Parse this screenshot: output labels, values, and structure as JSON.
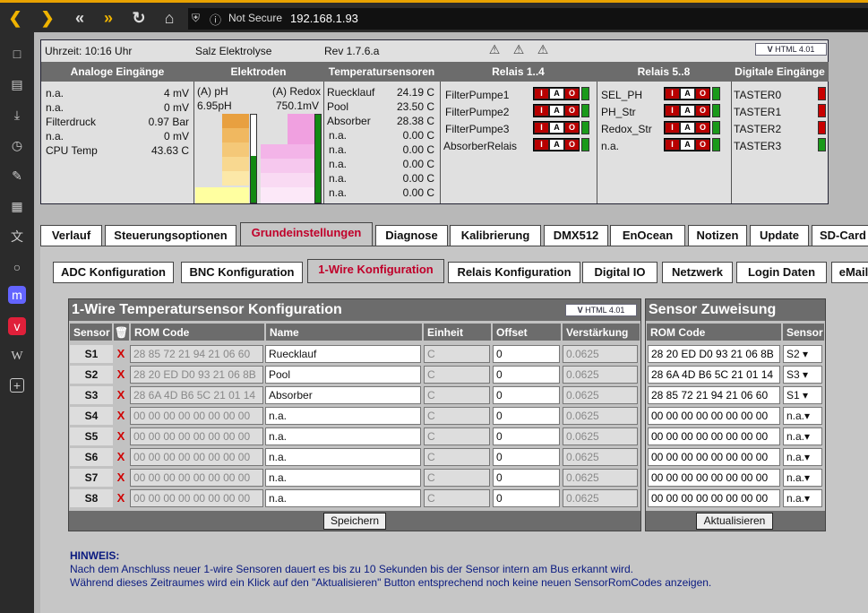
{
  "browser": {
    "not_secure": "Not Secure",
    "url": "192.168.1.93"
  },
  "status": {
    "time": "Uhrzeit: 10:16 Uhr",
    "mode": "Salz Elektrolyse",
    "rev": "Rev 1.7.6.a",
    "validator": "HTML 4.01",
    "headers": [
      "Analoge Eingänge",
      "Elektroden",
      "Temperatursensoren",
      "Relais 1..4",
      "Relais 5..8",
      "Digitale Eingänge"
    ],
    "analog": [
      {
        "label": "n.a.",
        "value": "4 mV"
      },
      {
        "label": "n.a.",
        "value": "0 mV"
      },
      {
        "label": "Filterdruck",
        "value": "0.97 Bar"
      },
      {
        "label": "n.a.",
        "value": "0 mV"
      },
      {
        "label": "CPU Temp",
        "value": "43.63 C"
      }
    ],
    "electrodes": {
      "ph_label": "(A) pH",
      "redox_label": "(A) Redox",
      "ph_value": "6.95pH",
      "redox_value": "750.1mV"
    },
    "temps": [
      {
        "label": "Ruecklauf",
        "value": "24.19 C"
      },
      {
        "label": "Pool",
        "value": "23.50 C"
      },
      {
        "label": "Absorber",
        "value": "28.38 C"
      },
      {
        "label": "n.a.",
        "value": "0.00 C"
      },
      {
        "label": "n.a.",
        "value": "0.00 C"
      },
      {
        "label": "n.a.",
        "value": "0.00 C"
      },
      {
        "label": "n.a.",
        "value": "0.00 C"
      },
      {
        "label": "n.a.",
        "value": "0.00 C"
      }
    ],
    "relays14": [
      "FilterPumpe1",
      "FilterPumpe2",
      "FilterPumpe3",
      "AbsorberRelais"
    ],
    "relays58": [
      "SEL_PH",
      "PH_Str",
      "Redox_Str",
      "n.a."
    ],
    "digital": [
      {
        "label": "TASTER0",
        "state": "off"
      },
      {
        "label": "TASTER1",
        "state": "off"
      },
      {
        "label": "TASTER2",
        "state": "off"
      },
      {
        "label": "TASTER3",
        "state": "on"
      }
    ],
    "iao": {
      "i": "I",
      "a": "A",
      "o": "O"
    }
  },
  "tabs": [
    "Verlauf",
    "Steuerungsoptionen",
    "Grundeinstellungen",
    "Diagnose",
    "Kalibrierung",
    "DMX512",
    "EnOcean",
    "Notizen",
    "Update",
    "SD-Card"
  ],
  "subtabs": [
    "ADC Konfiguration",
    "BNC Konfiguration",
    "1-Wire Konfiguration",
    "Relais Konfiguration",
    "Digital IO",
    "Netzwerk",
    "Login Daten",
    "eMail"
  ],
  "onewire": {
    "title": "1-Wire Temperatursensor Konfiguration",
    "validator": "HTML 4.01",
    "cols": {
      "sensor": "Sensor",
      "rom": "ROM Code",
      "name": "Name",
      "unit": "Einheit",
      "offset": "Offset",
      "gain": "Verstärkung"
    },
    "delete_glyph": "X",
    "rows": [
      {
        "id": "S1",
        "rom": "28 85 72 21 94 21 06 60",
        "name": "Ruecklauf",
        "unit": "C",
        "offset": "0",
        "gain": "0.0625"
      },
      {
        "id": "S2",
        "rom": "28 20 ED D0 93 21 06 8B",
        "name": "Pool",
        "unit": "C",
        "offset": "0",
        "gain": "0.0625"
      },
      {
        "id": "S3",
        "rom": "28 6A 4D B6 5C 21 01 14",
        "name": "Absorber",
        "unit": "C",
        "offset": "0",
        "gain": "0.0625"
      },
      {
        "id": "S4",
        "rom": "00 00 00 00 00 00 00 00",
        "name": "n.a.",
        "unit": "C",
        "offset": "0",
        "gain": "0.0625"
      },
      {
        "id": "S5",
        "rom": "00 00 00 00 00 00 00 00",
        "name": "n.a.",
        "unit": "C",
        "offset": "0",
        "gain": "0.0625"
      },
      {
        "id": "S6",
        "rom": "00 00 00 00 00 00 00 00",
        "name": "n.a.",
        "unit": "C",
        "offset": "0",
        "gain": "0.0625"
      },
      {
        "id": "S7",
        "rom": "00 00 00 00 00 00 00 00",
        "name": "n.a.",
        "unit": "C",
        "offset": "0",
        "gain": "0.0625"
      },
      {
        "id": "S8",
        "rom": "00 00 00 00 00 00 00 00",
        "name": "n.a.",
        "unit": "C",
        "offset": "0",
        "gain": "0.0625"
      }
    ],
    "save": "Speichern"
  },
  "assign": {
    "title": "Sensor Zuweisung",
    "cols": {
      "rom": "ROM Code",
      "sensor": "Sensor"
    },
    "rows": [
      {
        "rom": "28 20 ED D0 93 21 06 8B",
        "sensor": "S2 ▾"
      },
      {
        "rom": "28 6A 4D B6 5C 21 01 14",
        "sensor": "S3 ▾"
      },
      {
        "rom": "28 85 72 21 94 21 06 60",
        "sensor": "S1 ▾"
      },
      {
        "rom": "00 00 00 00 00 00 00 00",
        "sensor": "n.a.▾"
      },
      {
        "rom": "00 00 00 00 00 00 00 00",
        "sensor": "n.a.▾"
      },
      {
        "rom": "00 00 00 00 00 00 00 00",
        "sensor": "n.a.▾"
      },
      {
        "rom": "00 00 00 00 00 00 00 00",
        "sensor": "n.a.▾"
      },
      {
        "rom": "00 00 00 00 00 00 00 00",
        "sensor": "n.a.▾"
      }
    ],
    "refresh": "Aktualisieren"
  },
  "note": {
    "title": "HINWEIS:",
    "line1": "Nach dem Anschluss neuer 1-wire Sensoren dauert es bis zu 10 Sekunden bis der Sensor intern am Bus erkannt wird.",
    "line2": "Während dieses Zeitraumes wird ein Klick auf den \"Aktualisieren\" Button entsprechend noch keine neuen SensorRomCodes anzeigen."
  },
  "colors": {
    "led_on": "#1a9a1a",
    "led_off": "#c80000",
    "active_tab": "#c0002a",
    "delete": "#d00000"
  }
}
